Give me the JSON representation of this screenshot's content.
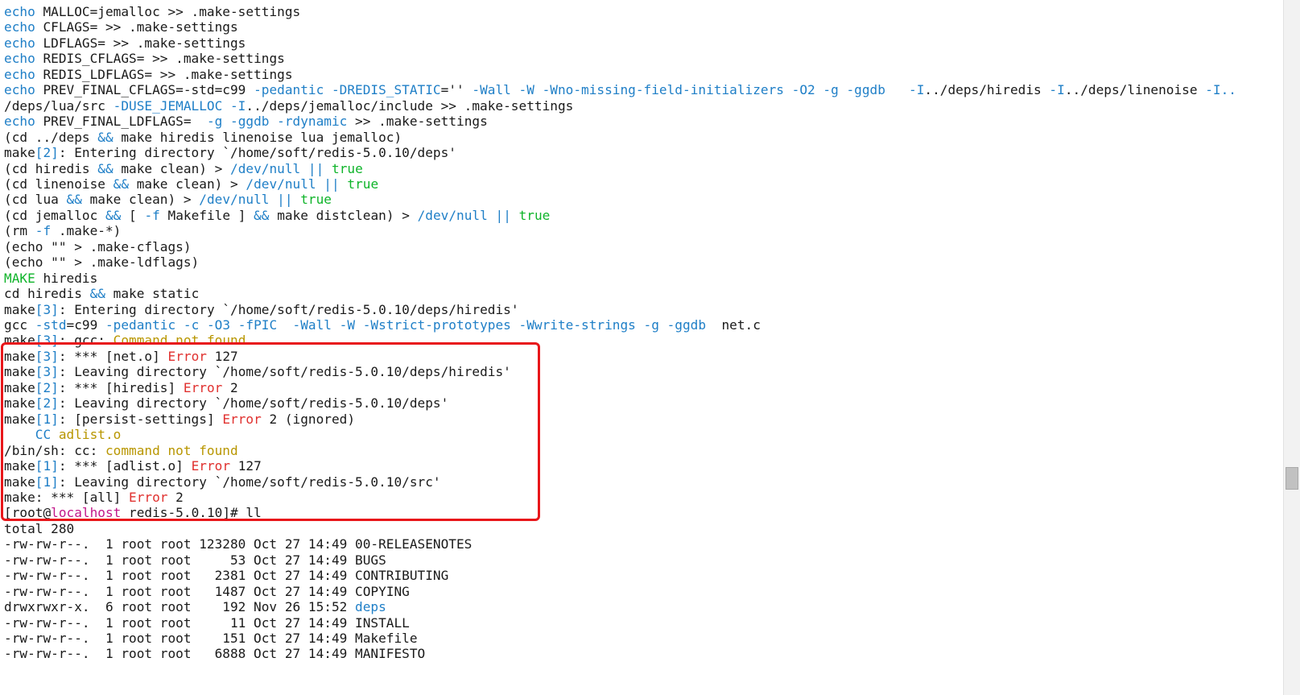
{
  "colors": {
    "background": "#ffffff",
    "text": "#1a1a1a",
    "command": "#1f7fc7",
    "option": "#1f7fc7",
    "keyword_green": "#0fb42a",
    "warning_yellow": "#b89600",
    "error_red": "#e0312f",
    "hostname_pink": "#c2188a",
    "highlight_border": "#e8161a"
  },
  "lines": [
    [
      {
        "t": "echo",
        "c": "cmd"
      },
      {
        "t": " MALLOC=jemalloc >> .make-settings"
      }
    ],
    [
      {
        "t": "echo",
        "c": "cmd"
      },
      {
        "t": " CFLAGS= >> .make-settings"
      }
    ],
    [
      {
        "t": "echo",
        "c": "cmd"
      },
      {
        "t": " LDFLAGS= >> .make-settings"
      }
    ],
    [
      {
        "t": "echo",
        "c": "cmd"
      },
      {
        "t": " REDIS_CFLAGS= >> .make-settings"
      }
    ],
    [
      {
        "t": "echo",
        "c": "cmd"
      },
      {
        "t": " REDIS_LDFLAGS= >> .make-settings"
      }
    ],
    [
      {
        "t": "echo",
        "c": "cmd"
      },
      {
        "t": " PREV_FINAL_CFLAGS=-std=c99 "
      },
      {
        "t": "-pedantic -DREDIS_STATIC",
        "c": "blue"
      },
      {
        "t": "='' "
      },
      {
        "t": "-Wall -W -Wno-missing-field-initializers -O2 -g -ggdb",
        "c": "blue"
      },
      {
        "t": "   "
      },
      {
        "t": "-I",
        "c": "blue"
      },
      {
        "t": "../deps/hiredis "
      },
      {
        "t": "-I",
        "c": "blue"
      },
      {
        "t": "../deps/linenoise "
      },
      {
        "t": "-I..",
        "c": "blue"
      }
    ],
    [
      {
        "t": "/deps/lua/src "
      },
      {
        "t": "-DUSE_JEMALLOC -I",
        "c": "blue"
      },
      {
        "t": "../deps/jemalloc/include >> .make-settings"
      }
    ],
    [
      {
        "t": "echo",
        "c": "cmd"
      },
      {
        "t": " PREV_FINAL_LDFLAGS=  "
      },
      {
        "t": "-g -ggdb -rdynamic",
        "c": "blue"
      },
      {
        "t": " >> .make-settings"
      }
    ],
    [
      {
        "t": "(cd ../deps "
      },
      {
        "t": "&&",
        "c": "blue"
      },
      {
        "t": " make hiredis linenoise lua jemalloc)"
      }
    ],
    [
      {
        "t": "make"
      },
      {
        "t": "[2]",
        "c": "blue"
      },
      {
        "t": ": Entering directory `/home/soft/redis-5.0.10/deps'"
      }
    ],
    [
      {
        "t": "(cd hiredis "
      },
      {
        "t": "&&",
        "c": "blue"
      },
      {
        "t": " make clean) > "
      },
      {
        "t": "/dev/null ||",
        "c": "blue"
      },
      {
        "t": " "
      },
      {
        "t": "true",
        "c": "green"
      }
    ],
    [
      {
        "t": "(cd linenoise "
      },
      {
        "t": "&&",
        "c": "blue"
      },
      {
        "t": " make clean) > "
      },
      {
        "t": "/dev/null ||",
        "c": "blue"
      },
      {
        "t": " "
      },
      {
        "t": "true",
        "c": "green"
      }
    ],
    [
      {
        "t": "(cd lua "
      },
      {
        "t": "&&",
        "c": "blue"
      },
      {
        "t": " make clean) > "
      },
      {
        "t": "/dev/null ||",
        "c": "blue"
      },
      {
        "t": " "
      },
      {
        "t": "true",
        "c": "green"
      }
    ],
    [
      {
        "t": "(cd jemalloc "
      },
      {
        "t": "&&",
        "c": "blue"
      },
      {
        "t": " [ "
      },
      {
        "t": "-f",
        "c": "blue"
      },
      {
        "t": " Makefile ] "
      },
      {
        "t": "&&",
        "c": "blue"
      },
      {
        "t": " make distclean) > "
      },
      {
        "t": "/dev/null ||",
        "c": "blue"
      },
      {
        "t": " "
      },
      {
        "t": "true",
        "c": "green"
      }
    ],
    [
      {
        "t": "(rm "
      },
      {
        "t": "-f",
        "c": "blue"
      },
      {
        "t": " .make-*)"
      }
    ],
    [
      {
        "t": "(echo \"\" > .make-cflags)"
      }
    ],
    [
      {
        "t": "(echo \"\" > .make-ldflags)"
      }
    ],
    [
      {
        "t": "MAKE",
        "c": "green"
      },
      {
        "t": " hiredis"
      }
    ],
    [
      {
        "t": "cd hiredis "
      },
      {
        "t": "&&",
        "c": "blue"
      },
      {
        "t": " make static"
      }
    ],
    [
      {
        "t": "make"
      },
      {
        "t": "[3]",
        "c": "blue"
      },
      {
        "t": ": Entering directory `/home/soft/redis-5.0.10/deps/hiredis'"
      }
    ],
    [
      {
        "t": "gcc "
      },
      {
        "t": "-std",
        "c": "blue"
      },
      {
        "t": "=c99 "
      },
      {
        "t": "-pedantic -c -O3 -fPIC  -Wall -W -Wstrict-prototypes -Wwrite-strings -g -ggdb",
        "c": "blue"
      },
      {
        "t": "  net.c"
      }
    ],
    [
      {
        "t": "make"
      },
      {
        "t": "[3]",
        "c": "blue"
      },
      {
        "t": ": gcc: "
      },
      {
        "t": "Command not found",
        "c": "yellow"
      }
    ],
    [
      {
        "t": "make"
      },
      {
        "t": "[3]",
        "c": "blue"
      },
      {
        "t": ": *** [net.o] "
      },
      {
        "t": "Error",
        "c": "red"
      },
      {
        "t": " 127"
      }
    ],
    [
      {
        "t": "make"
      },
      {
        "t": "[3]",
        "c": "blue"
      },
      {
        "t": ": Leaving directory `/home/soft/redis-5.0.10/deps/hiredis'"
      }
    ],
    [
      {
        "t": "make"
      },
      {
        "t": "[2]",
        "c": "blue"
      },
      {
        "t": ": *** [hiredis] "
      },
      {
        "t": "Error",
        "c": "red"
      },
      {
        "t": " 2"
      }
    ],
    [
      {
        "t": "make"
      },
      {
        "t": "[2]",
        "c": "blue"
      },
      {
        "t": ": Leaving directory `/home/soft/redis-5.0.10/deps'"
      }
    ],
    [
      {
        "t": "make"
      },
      {
        "t": "[1]",
        "c": "blue"
      },
      {
        "t": ": [persist-settings] "
      },
      {
        "t": "Error",
        "c": "red"
      },
      {
        "t": " 2 (ignored)"
      }
    ],
    [
      {
        "t": "    "
      },
      {
        "t": "CC",
        "c": "blue"
      },
      {
        "t": " "
      },
      {
        "t": "adlist.o",
        "c": "yellow"
      }
    ],
    [
      {
        "t": "/bin/sh: cc: "
      },
      {
        "t": "command not found",
        "c": "yellow"
      }
    ],
    [
      {
        "t": "make"
      },
      {
        "t": "[1]",
        "c": "blue"
      },
      {
        "t": ": *** [adlist.o] "
      },
      {
        "t": "Error",
        "c": "red"
      },
      {
        "t": " 127"
      }
    ],
    [
      {
        "t": "make"
      },
      {
        "t": "[1]",
        "c": "blue"
      },
      {
        "t": ": Leaving directory `/home/soft/redis-5.0.10/src'"
      }
    ],
    [
      {
        "t": "make: *** [all] "
      },
      {
        "t": "Error",
        "c": "red"
      },
      {
        "t": " 2"
      }
    ],
    [
      {
        "t": "[root@"
      },
      {
        "t": "localhost",
        "c": "pink"
      },
      {
        "t": " redis-5.0.10]# ll"
      }
    ],
    [
      {
        "t": "total 280"
      }
    ],
    [
      {
        "t": "-rw-rw-r--.  1 root root 123280 Oct 27 14:49 00-RELEASENOTES"
      }
    ],
    [
      {
        "t": "-rw-rw-r--.  1 root root     53 Oct 27 14:49 BUGS"
      }
    ],
    [
      {
        "t": "-rw-rw-r--.  1 root root   2381 Oct 27 14:49 CONTRIBUTING"
      }
    ],
    [
      {
        "t": "-rw-rw-r--.  1 root root   1487 Oct 27 14:49 COPYING"
      }
    ],
    [
      {
        "t": "drwxrwxr-x.  6 root root    192 Nov 26 15:52 "
      },
      {
        "t": "deps",
        "c": "blue"
      }
    ],
    [
      {
        "t": "-rw-rw-r--.  1 root root     11 Oct 27 14:49 INSTALL"
      }
    ],
    [
      {
        "t": "-rw-rw-r--.  1 root root    151 Oct 27 14:49 Makefile"
      }
    ],
    [
      {
        "t": "-rw-rw-r--.  1 root root   6888 Oct 27 14:49 MANIFESTO"
      }
    ]
  ]
}
